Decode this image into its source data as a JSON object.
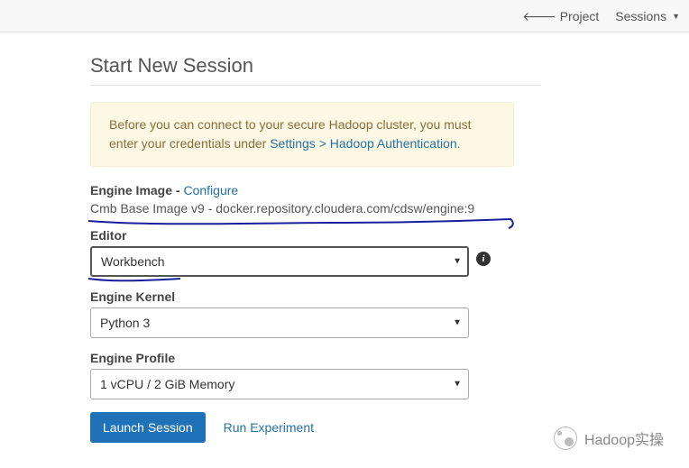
{
  "topbar": {
    "project_link": "Project",
    "sessions_link": "Sessions"
  },
  "page_title": "Start New Session",
  "alert": {
    "text_before": "Before you can connect to your secure Hadoop cluster, you must enter your credentials under ",
    "link_text": "Settings > Hadoop Authentication",
    "text_after": "."
  },
  "engine_image": {
    "label": "Engine Image",
    "separator": " - ",
    "configure_link": "Configure",
    "value": "Cmb Base Image v9 - docker.repository.cloudera.com/cdsw/engine:9"
  },
  "editor": {
    "label": "Editor",
    "value": "Workbench"
  },
  "engine_kernel": {
    "label": "Engine Kernel",
    "value": "Python 3"
  },
  "engine_profile": {
    "label": "Engine Profile",
    "value": "1 vCPU / 2 GiB Memory"
  },
  "buttons": {
    "launch": "Launch Session",
    "run_experiment": "Run Experiment"
  },
  "watermark": "Hadoop实操"
}
